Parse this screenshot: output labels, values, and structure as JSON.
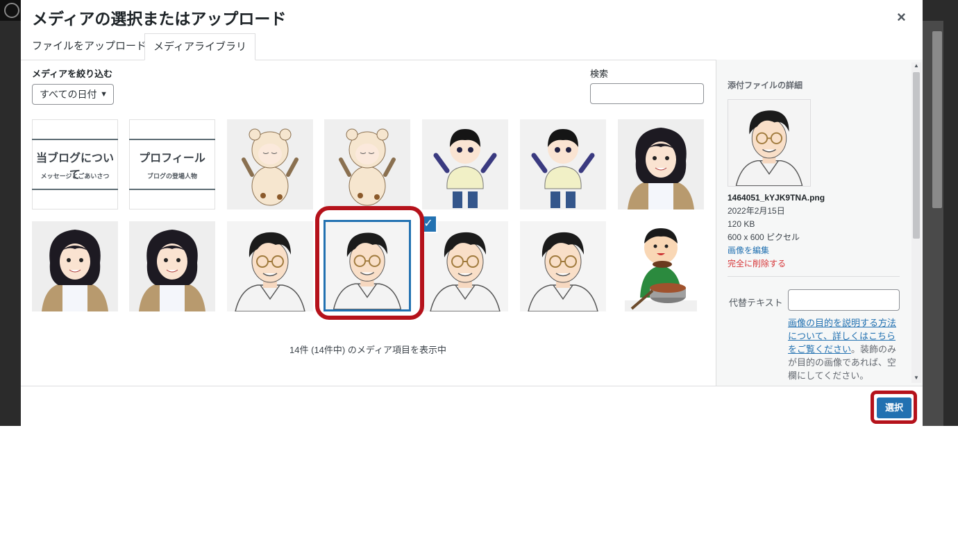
{
  "modal": {
    "title": "メディアの選択またはアップロード",
    "close": "×"
  },
  "tabs": [
    {
      "label": "ファイルをアップロード"
    },
    {
      "label": "メディアライブラリ"
    }
  ],
  "filter": {
    "label": "メディアを絞り込む",
    "date_selected": "すべての日付"
  },
  "search": {
    "label": "検索",
    "value": ""
  },
  "text_cards": [
    {
      "title": "当ブログについて",
      "subtitle": "メッセージとごあいさつ"
    },
    {
      "title": "プロフィール",
      "subtitle": "ブログの登場人物"
    }
  ],
  "count_text": "14件 (14件中) のメディア項目を表示中",
  "sidebar": {
    "heading": "添付ファイルの詳細",
    "filename": "1464051_kYJK9TNA.png",
    "date": "2022年2月15日",
    "size": "120 KB",
    "dimensions": "600 x 600 ピクセル",
    "edit_link": "画像を編集",
    "delete_link": "完全に削除する",
    "alt_label": "代替テキスト",
    "alt_value": "",
    "alt_help_link": "画像の目的を説明する方法について、詳しくはこちらをご覧ください",
    "alt_help_text": "。装飾のみが目的の画像であれば、空欄にしてください。"
  },
  "select_button": "選択",
  "colors": {
    "accent": "#2271b1",
    "highlight": "#b5121b",
    "delete": "#d63638"
  }
}
